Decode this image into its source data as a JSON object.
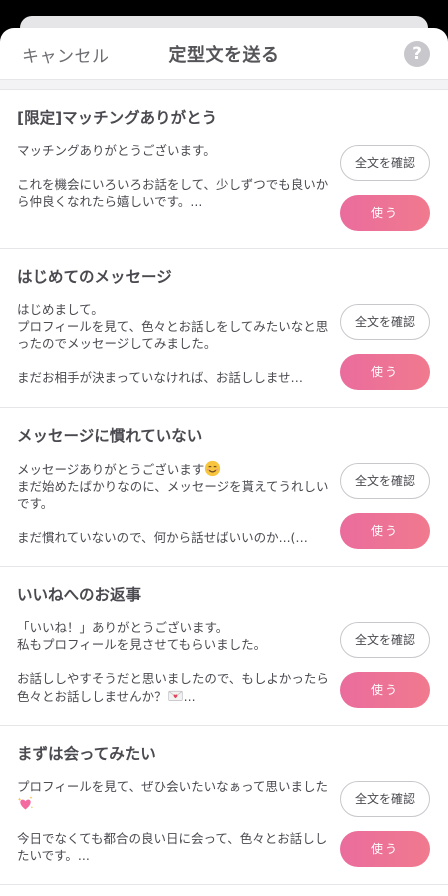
{
  "header": {
    "cancel_label": "キャンセル",
    "title": "定型文を送る",
    "help_label": "?"
  },
  "buttons": {
    "view_full_label": "全文を確認",
    "use_label": "使う"
  },
  "templates": [
    {
      "title": "[限定]マッチングありがとう",
      "body": "マッチングありがとうございます。\n\nこれを機会にいろいろお話をして、少しずつでも良いから仲良くなれたら嬉しいです。..."
    },
    {
      "title": "はじめてのメッセージ",
      "body": "はじめまして。\nプロフィールを見て、色々とお話しをしてみたいなと思ったのでメッセージしてみました。\n\nまだお相手が決まっていなければ、お話ししませ…"
    },
    {
      "title": "メッセージに慣れていない",
      "body_pre": "メッセージありがとうございます",
      "body_emoji": "smiling-face-emoji",
      "body_post": "\nまだ始めたばかりなのに、メッセージを貰えてうれしいです。\n\nまだ慣れていないので、何から話せばいいのか...(…"
    },
    {
      "title": "いいねへのお返事",
      "body_pre": "「いいね！」ありがとうございます。\n私もプロフィールを見させてもらいました。\n\nお話ししやすそうだと思いましたので、もしよかったら色々とお話ししませんか？",
      "body_emoji": "love-letter-emoji",
      "body_post": "..."
    },
    {
      "title": "まずは会ってみたい",
      "body_pre": "プロフィールを見て、ぜひ会いたいなぁって思いました",
      "body_emoji": "sparkling-heart-emoji",
      "body_post": "\n\n今日でなくても都合の良い日に会って、色々とお話ししたいです。..."
    }
  ],
  "colors": {
    "accent_pink": "#ea6c9d",
    "accent_coral": "#f07a8e",
    "text": "#4a4a50"
  }
}
